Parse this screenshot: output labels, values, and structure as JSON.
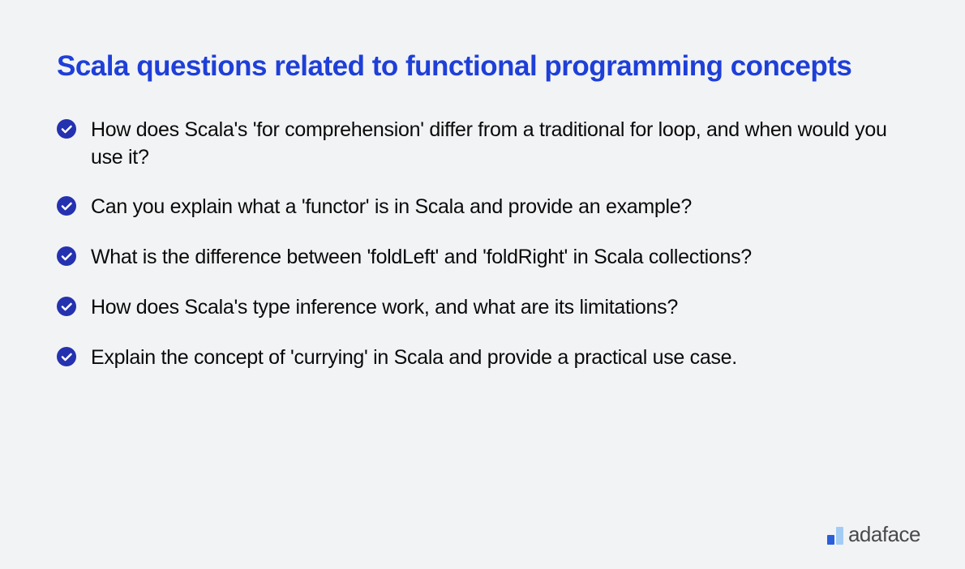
{
  "title": "Scala questions related to functional programming concepts",
  "questions": [
    "How does Scala's 'for comprehension' differ from a traditional for loop, and when would you use it?",
    "Can you explain what a 'functor' is in Scala and provide an example?",
    "What is the difference between 'foldLeft' and 'foldRight' in Scala collections?",
    "How does Scala's type inference work, and what are its limitations?",
    "Explain the concept of 'currying' in Scala and provide a practical use case."
  ],
  "logo": {
    "text": "adaface"
  }
}
